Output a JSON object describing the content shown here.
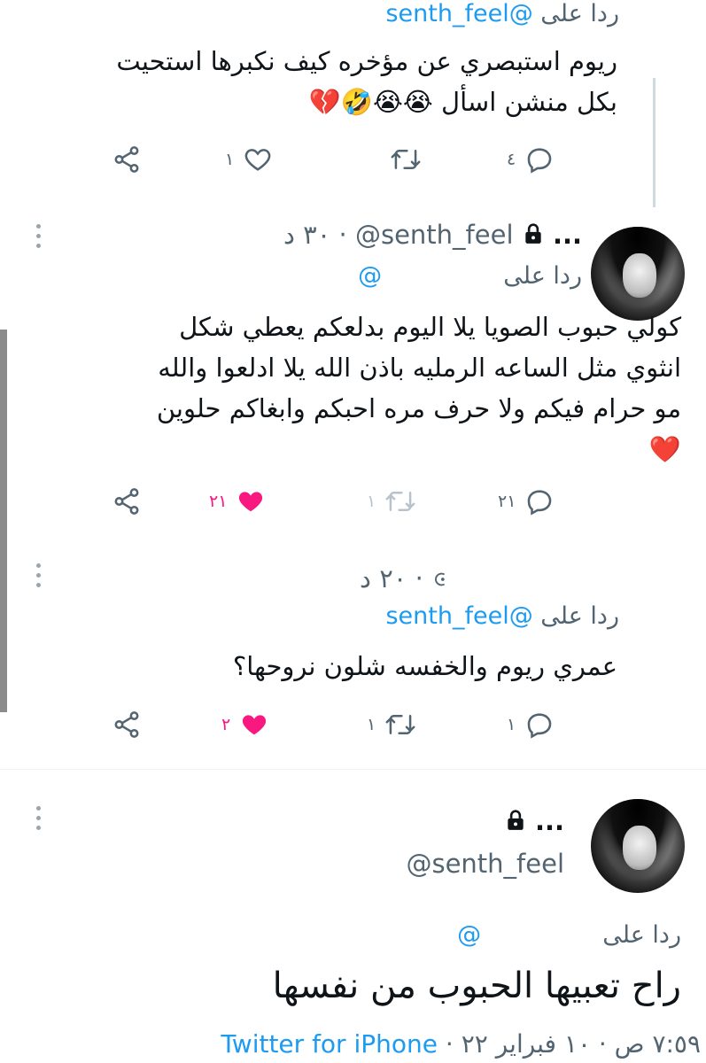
{
  "tweets": [
    {
      "reply_prefix": "ردا على",
      "reply_handle": "@senth_feel",
      "lines": [
        "ريوم استبصري عن مؤخره كيف نكبرها استحيت",
        "بكل منشن اسأل 😭😭🤣💔"
      ],
      "actions": {
        "reply_count": "٤",
        "retweet_count": "",
        "like_count": "١"
      }
    },
    {
      "more": "...",
      "handle": "@senth_feel",
      "time_sep": "·",
      "time": "٣٠ د",
      "reply_prefix": "ردا على",
      "reply_handle": "@",
      "lines": [
        "كولي حبوب الصويا يلا اليوم بدلعكم يعطي شكل",
        "انثوي مثل الساعه الرمليه باذن الله يلا ادلعوا والله",
        "مو حرام فيكم ولا حرف مره احبكم وابغاكم حلوين",
        "❤️"
      ],
      "actions": {
        "reply_count": "٢١",
        "retweet_count": "١",
        "like_count": "٢١"
      }
    },
    {
      "time": "٢٠ د",
      "time_sep": "·",
      "reply_prefix": "ردا على",
      "reply_handle": "@senth_feel",
      "lines": [
        "عمري ريوم والخفسه شلون نروحها؟"
      ],
      "actions": {
        "reply_count": "١",
        "retweet_count": "١",
        "like_count": "٢"
      }
    },
    {
      "more": "...",
      "handle": "@senth_feel",
      "reply_prefix": "ردا على",
      "reply_handle": "@",
      "main_text": "راح تعبيها الحبوب من نفسها",
      "meta_time": "٧:٥٩ ص · ١٠ فبراير ٢٢",
      "meta_sep": "·",
      "source": "Twitter for iPhone"
    }
  ],
  "colors": {
    "link": "#1d9bf0",
    "muted": "#536471",
    "like_active": "#f91880",
    "text": "#0f1419"
  },
  "icons": [
    "share-icon",
    "like-heart-icon",
    "retweet-icon",
    "reply-icon",
    "lock-icon",
    "more-dots-icon",
    "avatar"
  ]
}
